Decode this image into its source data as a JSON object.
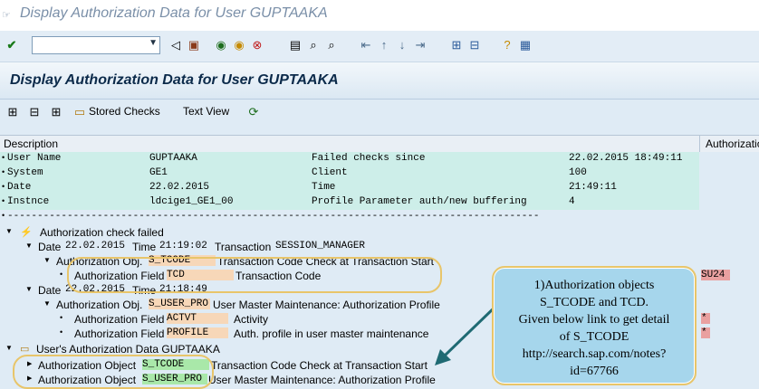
{
  "window": {
    "title": "Display Authorization Data for User GUPTAAKA"
  },
  "toolbar": {
    "command_field": {
      "value": ""
    }
  },
  "header": {
    "title": "Display Authorization Data for User GUPTAAKA"
  },
  "app_toolbar": {
    "stored_checks": "Stored Checks",
    "text_view": "Text View"
  },
  "columns": {
    "description": "Description",
    "authorization": "Authorizatio"
  },
  "info": [
    [
      "User Name",
      "GUPTAAKA",
      "Failed checks since",
      "22.02.2015 18:49:11"
    ],
    [
      "System",
      "GE1",
      "Client",
      "100"
    ],
    [
      "Date",
      "22.02.2015",
      "Time",
      "21:49:11"
    ],
    [
      "Instnce",
      "ldcige1_GE1_00",
      "Profile Parameter auth/new buffering",
      "4"
    ]
  ],
  "separator": "-----------------------------------------------------------------------------------------",
  "tree": {
    "failed": "Authorization check failed",
    "date1": {
      "date_label": "Date",
      "date": "22.02.2015",
      "time_label": "Time",
      "time": "21:19:02",
      "tx_label": "Transaction",
      "tx": "SESSION_MANAGER"
    },
    "obj1": {
      "label": "Authorization Obj.",
      "name": "S_TCODE",
      "desc": "Transaction Code Check at Transaction Start"
    },
    "field1": {
      "label": "Authorization Field",
      "name": "TCD",
      "desc": "Transaction Code",
      "value": "SU24"
    },
    "date2": {
      "date_label": "Date",
      "date": "22.02.2015",
      "time_label": "Time",
      "time": "21:18:49"
    },
    "obj2": {
      "label": "Authorization Obj.",
      "name": "S_USER_PRO",
      "desc": "User Master Maintenance: Authorization Profile"
    },
    "field2": {
      "label": "Authorization Field",
      "name": "ACTVT",
      "desc": "Activity",
      "value": "*"
    },
    "field3": {
      "label": "Authorization Field",
      "name": "PROFILE",
      "desc": "Auth. profile in user master maintenance",
      "value": "*"
    },
    "user_auth": "User's Authorization Data GUPTAAKA",
    "uobj1": {
      "label": "Authorization Object",
      "name": "S_TCODE",
      "desc": "Transaction Code Check at Transaction Start"
    },
    "uobj2": {
      "label": "Authorization Object",
      "name": "S_USER_PRO",
      "desc": "User Master Maintenance: Authorization Profile"
    }
  },
  "callout": {
    "lines": [
      "1)Authorization objects",
      "S_TCODE and TCD.",
      "Given below link to get detail",
      "of S_TCODE",
      "http://search.sap.com/notes?",
      "id=67766"
    ]
  },
  "colors": {
    "info_bg": "#cdeee9",
    "highlight_orange": "#f7d7b8",
    "highlight_green": "#a9e8a9",
    "value_pink": "#e9a0a0",
    "callout_border": "#e8c56a",
    "callout_bg": "#a6d6ec"
  }
}
